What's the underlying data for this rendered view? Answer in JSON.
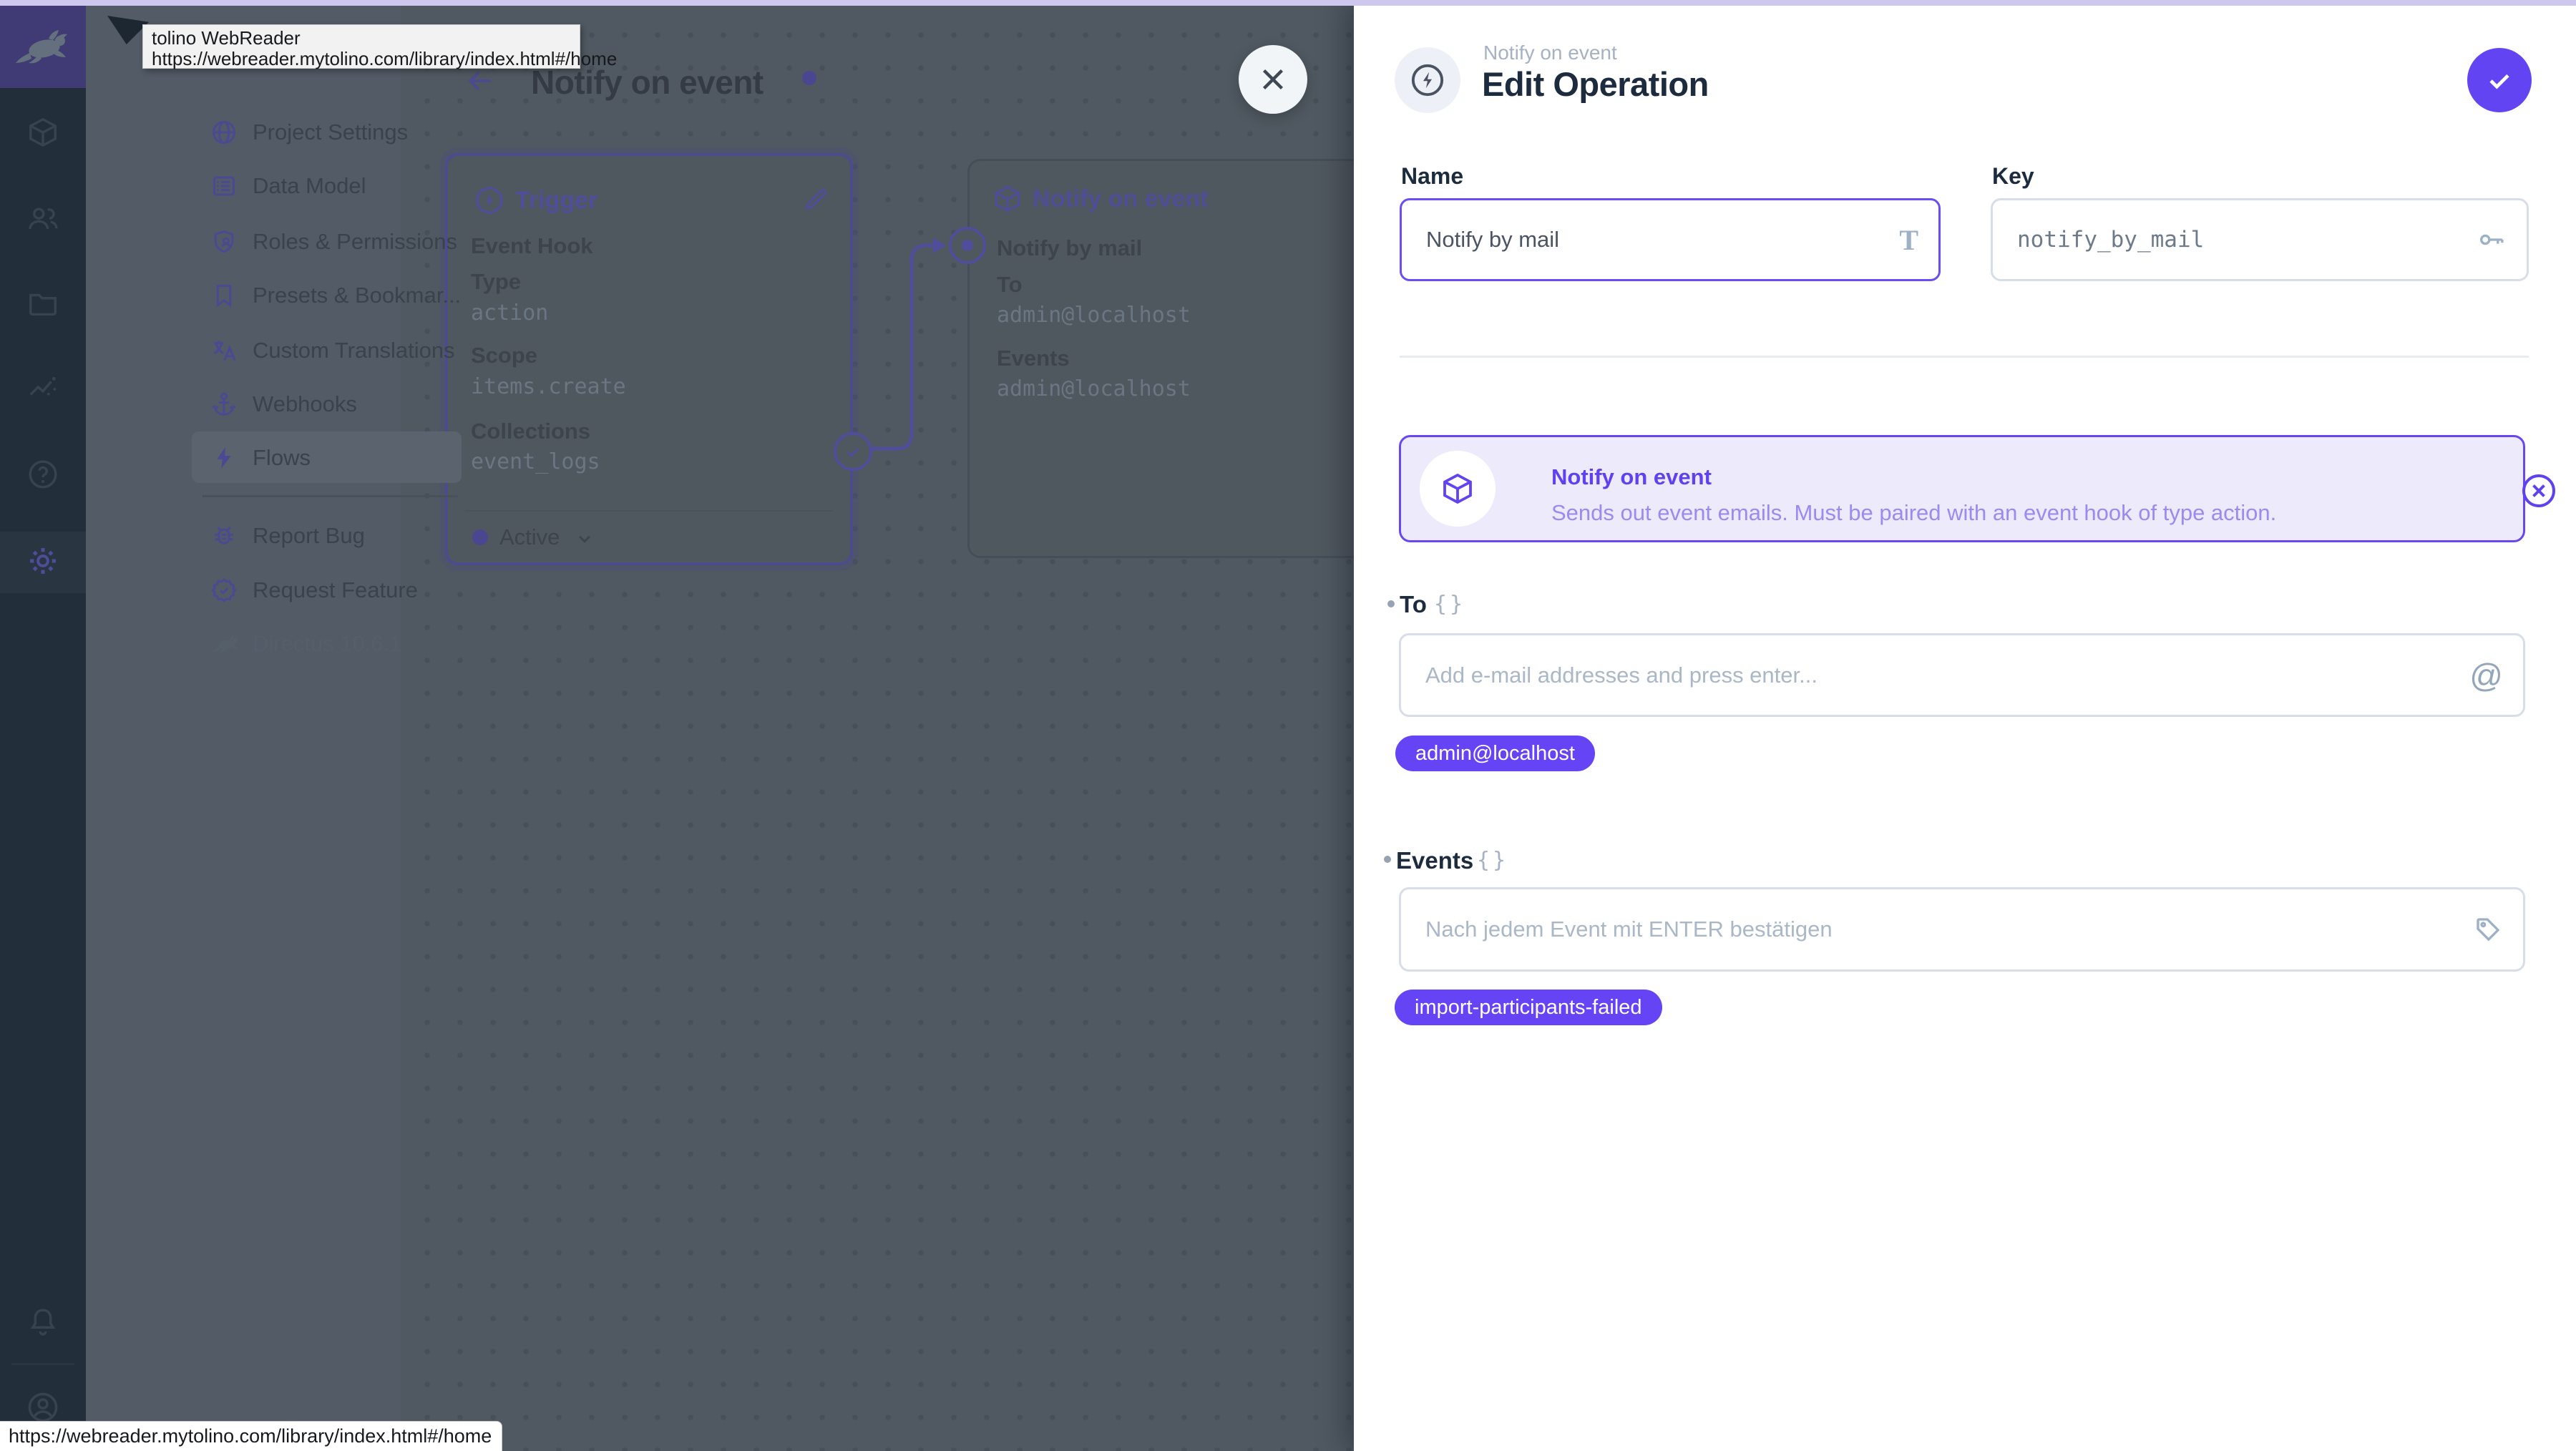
{
  "colors": {
    "accent": "#6644ff",
    "dim_purple": "#504e9a",
    "chip_bg": "#6544f5",
    "notice_bg": "#edeafc"
  },
  "browser": {
    "tooltip_title": "tolino WebReader",
    "tooltip_url": "https://webreader.mytolino.com/library/index.html#/home",
    "status_url": "https://webreader.mytolino.com/library/index.html#/home"
  },
  "sidebar": {
    "modules": [
      "collections",
      "users",
      "files",
      "insights",
      "docs",
      "settings",
      "notifications",
      "account"
    ],
    "nav_items": [
      {
        "label": "Project Settings",
        "icon": "globe"
      },
      {
        "label": "Data Model",
        "icon": "list-alt"
      },
      {
        "label": "Roles & Permissions",
        "icon": "shield-user"
      },
      {
        "label": "Presets & Bookmar...",
        "icon": "bookmark"
      },
      {
        "label": "Custom Translations",
        "icon": "translate"
      },
      {
        "label": "Webhooks",
        "icon": "anchor"
      },
      {
        "label": "Flows",
        "icon": "bolt"
      },
      {
        "label": "Report Bug",
        "icon": "bug"
      },
      {
        "label": "Request Feature",
        "icon": "verified-badge"
      }
    ],
    "version": "Directus 10.6.1"
  },
  "canvas": {
    "title": "Notify on event",
    "trigger_card": {
      "title": "Trigger",
      "subtitle": "Event Hook",
      "fields": [
        {
          "label": "Type",
          "value": "action"
        },
        {
          "label": "Scope",
          "value": "items.create"
        },
        {
          "label": "Collections",
          "value": "event_logs"
        }
      ],
      "status": "Active"
    },
    "operation_card": {
      "title": "Notify on event",
      "name": "Notify by mail",
      "fields": [
        {
          "label": "To",
          "value": "admin@localhost"
        },
        {
          "label": "Events",
          "value": "admin@localhost"
        }
      ]
    }
  },
  "drawer": {
    "context": "Notify on event",
    "title": "Edit Operation",
    "name": {
      "label": "Name",
      "value": "Notify by mail"
    },
    "key": {
      "label": "Key",
      "value": "notify_by_mail"
    },
    "notice": {
      "title": "Notify on event",
      "description": "Sends out event emails. Must be paired with an event hook of type action."
    },
    "to": {
      "label": "To",
      "braces": "{}",
      "placeholder": "Add e-mail addresses and press enter...",
      "chips": [
        "admin@localhost"
      ]
    },
    "events": {
      "label": "Events",
      "braces": "{}",
      "placeholder": "Nach jedem Event mit ENTER bestätigen",
      "chips": [
        "import-participants-failed"
      ]
    }
  }
}
